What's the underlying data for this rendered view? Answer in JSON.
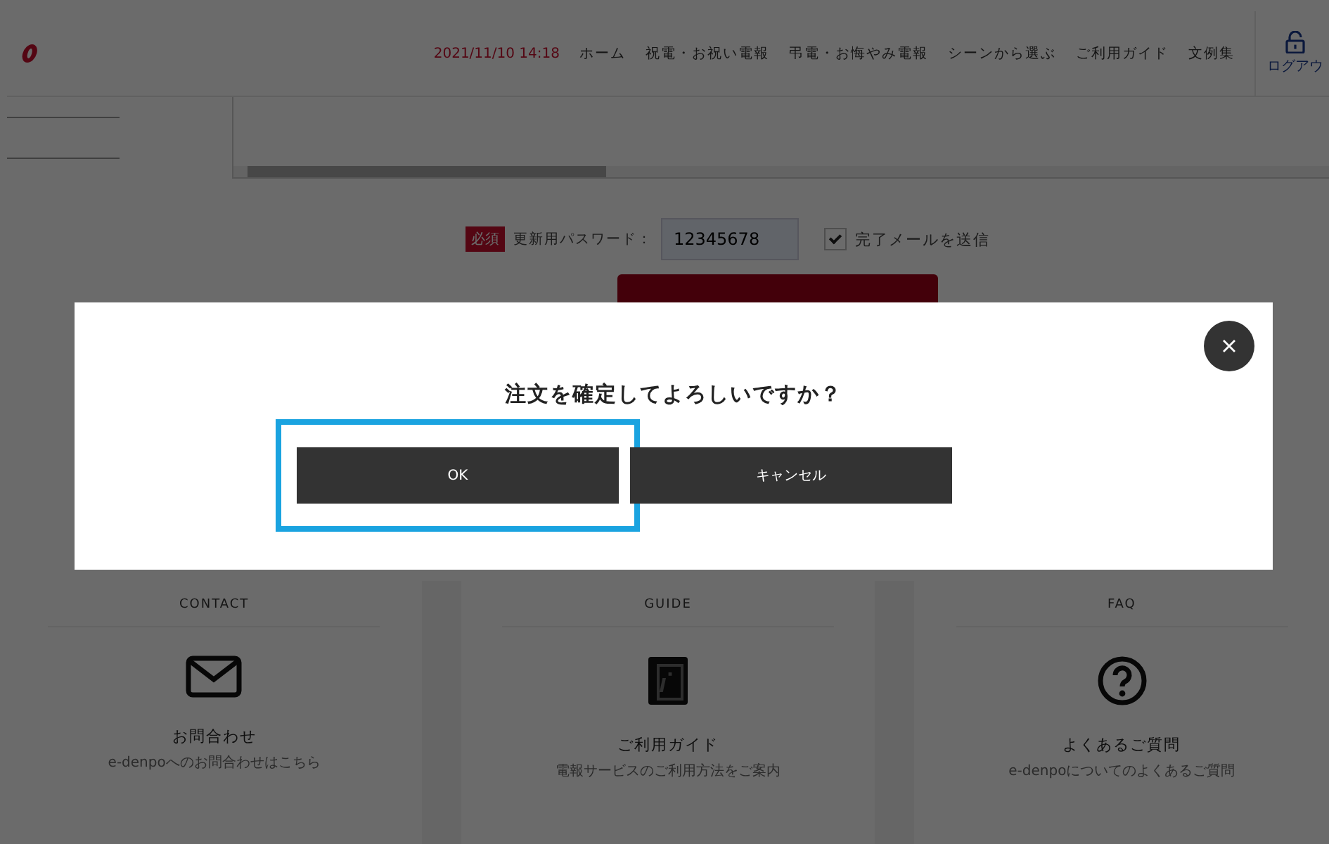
{
  "header": {
    "datetime": "2021/11/10 14:18",
    "nav": [
      "ホーム",
      "祝電・お祝い電報",
      "弔電・お悔やみ電報",
      "シーンから選ぶ",
      "ご利用ガイド",
      "文例集"
    ],
    "logout": "ログアウ"
  },
  "form": {
    "required_badge": "必須",
    "password_label": "更新用パスワード：",
    "password_value": "12345678",
    "send_mail": {
      "label": "完了メールを送信",
      "checked": true
    }
  },
  "dialog": {
    "message": "注文を確定してよろしいですか？",
    "buttons": [
      {
        "label": "OK",
        "focused": true
      },
      {
        "label": "キャンセル",
        "focused": false
      }
    ]
  },
  "footer": [
    {
      "heading": "CONTACT",
      "kind": "mail",
      "title": "お問合わせ",
      "subtitle": "e-denpoへのお問合わせはこちら"
    },
    {
      "heading": "GUIDE",
      "kind": "guide",
      "title": "ご利用ガイド",
      "subtitle": "電報サービスのご利用方法をご案内"
    },
    {
      "heading": "FAQ",
      "kind": "help",
      "title": "よくあるご質問",
      "subtitle": "e-denpoについてのよくあるご質問"
    }
  ]
}
